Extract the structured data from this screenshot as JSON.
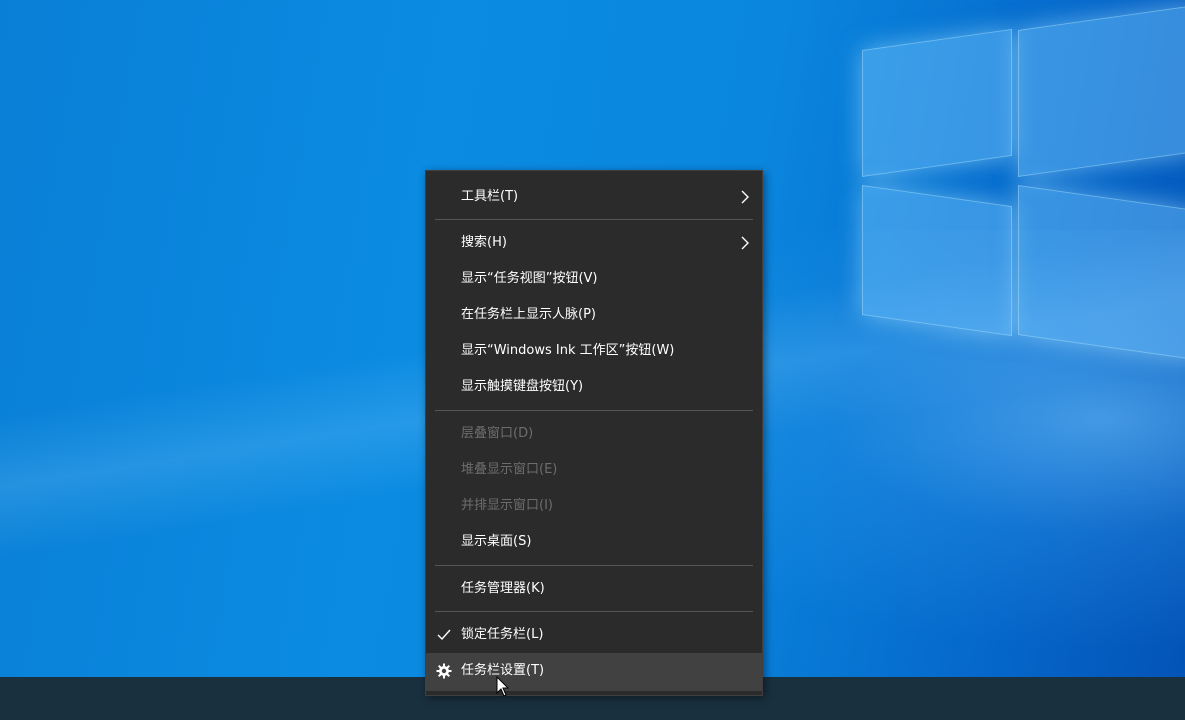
{
  "menu": {
    "items": [
      {
        "label": "工具栏(T)",
        "submenu": true
      },
      {
        "label": "搜索(H)",
        "submenu": true
      },
      {
        "label": "显示“任务视图”按钮(V)"
      },
      {
        "label": "在任务栏上显示人脉(P)"
      },
      {
        "label": "显示“Windows Ink 工作区”按钮(W)"
      },
      {
        "label": "显示触摸键盘按钮(Y)"
      },
      {
        "label": "层叠窗口(D)",
        "disabled": true
      },
      {
        "label": "堆叠显示窗口(E)",
        "disabled": true
      },
      {
        "label": "并排显示窗口(I)",
        "disabled": true
      },
      {
        "label": "显示桌面(S)"
      },
      {
        "label": "任务管理器(K)"
      },
      {
        "label": "锁定任务栏(L)",
        "checked": true
      },
      {
        "label": "任务栏设置(T)",
        "icon": "gear-icon",
        "hovered": true
      }
    ]
  },
  "colors": {
    "menu_bg": "#2b2b2b",
    "hover_bg": "#414141",
    "disabled_text": "#6d6d6d",
    "taskbar": "#19303f"
  }
}
